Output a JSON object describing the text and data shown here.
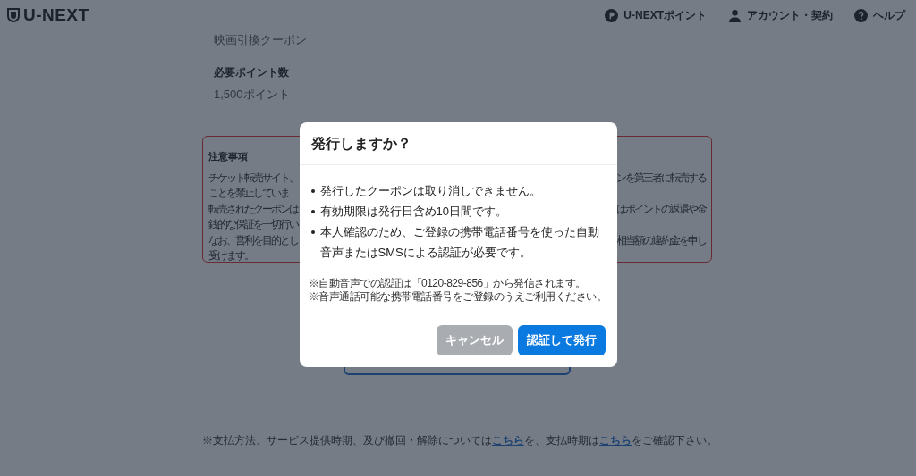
{
  "header": {
    "logo": "U-NEXT",
    "nav": [
      {
        "kind": "points",
        "label": "U-NEXTポイント"
      },
      {
        "kind": "account",
        "label": "アカウント・契約"
      },
      {
        "kind": "help",
        "label": "ヘルプ"
      }
    ]
  },
  "product": {
    "value": "映画引換クーポン"
  },
  "points": {
    "label": "必要ポイント数",
    "value": "1,500ポイント"
  },
  "notice": {
    "title": "注意事項",
    "lines": [
      {
        "left": "チケット転売サイト、",
        "right": "ンを第三者に転売する"
      },
      {
        "left": "ことを禁止していま"
      },
      {
        "left": "転売されたクーポンは",
        "right": "はポイントの返還や金"
      },
      {
        "left": "銭的な保証を一切行い"
      },
      {
        "left": "なお、営利を目的とし",
        "right": "相当額の違約金を申し"
      },
      {
        "left": "受けます。"
      }
    ]
  },
  "footer": [
    {
      "kind": "text",
      "text": "※支払方法、サービス提供時期、及び撤回・解除については"
    },
    {
      "kind": "link",
      "text": "こちら"
    },
    {
      "kind": "text",
      "text": "を、支払時期は"
    },
    {
      "kind": "link",
      "text": "こちら"
    },
    {
      "kind": "text",
      "text": "をご確認下さい。"
    }
  ],
  "dialog": {
    "title": "発行しますか？",
    "bullets": [
      "発行したクーポンは取り消しできません。",
      "有効期限は発行日含め10日間です。",
      "本人確認のため、ご登録の携帯電話番号を使った自動音声またはSMSによる認証が必要です。"
    ],
    "notes": [
      "※自動音声での認証は「0120-829-856」から発信されます。",
      "※音声通話可能な携帯電話番号をご登録のうえご利用ください。"
    ],
    "buttons": [
      {
        "kind": "secondary",
        "label": "キャンセル"
      },
      {
        "kind": "primary",
        "label": "認証して発行"
      }
    ]
  }
}
